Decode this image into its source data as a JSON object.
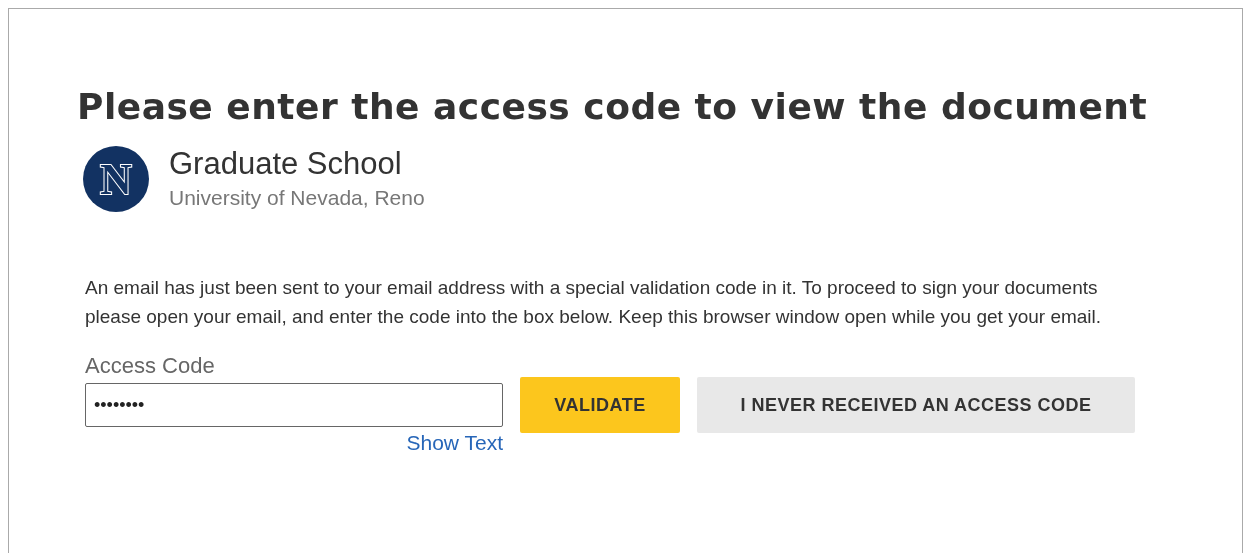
{
  "heading": "Please enter the access code to view the document",
  "sender": {
    "logo_letter": "N",
    "name": "Graduate School",
    "organization": "University of Nevada, Reno"
  },
  "message": "An email has just been sent to your email address with a special validation code in it. To proceed to sign your documents please open your email, and enter the code into the box below. Keep this browser window open while you get your email.",
  "access_code": {
    "label": "Access Code",
    "value": "••••••••",
    "toggle": "Show Text"
  },
  "buttons": [
    {
      "label": "VALIDATE",
      "kind": "primary"
    },
    {
      "label": "I NEVER RECEIVED AN ACCESS CODE",
      "kind": "secondary"
    }
  ]
}
